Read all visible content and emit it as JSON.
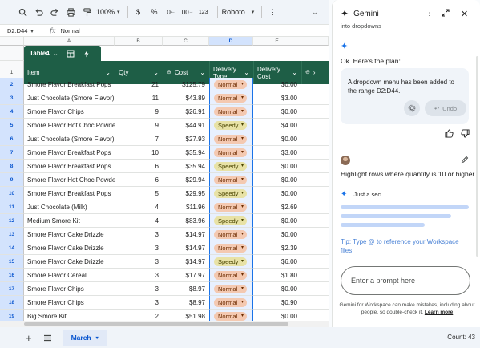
{
  "toolbar": {
    "zoom": "100%",
    "currency": "$",
    "percent": "%",
    "dec_decrease": ".0",
    "dec_increase": ".00",
    "format_123": "123",
    "font": "Roboto"
  },
  "formula_bar": {
    "range": "D2:D44",
    "fx": "fx",
    "value": "Normal"
  },
  "columns": [
    "A",
    "B",
    "C",
    "D",
    "E"
  ],
  "table": {
    "name": "Table4",
    "headers": [
      "Item",
      "Qty",
      "Cost",
      "Delivery Type",
      "Delivery Cost"
    ],
    "header_lines": {
      "delivery_type": [
        "Delivery",
        "Type"
      ],
      "delivery_cost": [
        "Delivery",
        "Cost"
      ]
    },
    "rows": [
      {
        "n": "2",
        "item": "Smore Flavor Breakfast Pops",
        "qty": "21",
        "cost": "$125.79",
        "type": "Normal",
        "dcost": "$0.00"
      },
      {
        "n": "3",
        "item": "Just Chocolate (Smore Flavor)",
        "qty": "11",
        "cost": "$43.89",
        "type": "Normal",
        "dcost": "$3.00"
      },
      {
        "n": "4",
        "item": "Smore Flavor Chips",
        "qty": "9",
        "cost": "$26.91",
        "type": "Normal",
        "dcost": "$0.00"
      },
      {
        "n": "5",
        "item": "Smore Flavor Hot Choc Powder",
        "qty": "9",
        "cost": "$44.91",
        "type": "Speedy",
        "dcost": "$4.00"
      },
      {
        "n": "6",
        "item": "Just Chocolate (Smore Flavor)",
        "qty": "7",
        "cost": "$27.93",
        "type": "Normal",
        "dcost": "$0.00"
      },
      {
        "n": "7",
        "item": "Smore Flavor Breakfast Pops",
        "qty": "10",
        "cost": "$35.94",
        "type": "Normal",
        "dcost": "$3.00"
      },
      {
        "n": "8",
        "item": "Smore Flavor Breakfast Pops",
        "qty": "6",
        "cost": "$35.94",
        "type": "Speedy",
        "dcost": "$0.00"
      },
      {
        "n": "9",
        "item": "Smore Flavor Hot Choc Powder",
        "qty": "6",
        "cost": "$29.94",
        "type": "Normal",
        "dcost": "$0.00"
      },
      {
        "n": "10",
        "item": "Smore Flavor Breakfast Pops",
        "qty": "5",
        "cost": "$29.95",
        "type": "Speedy",
        "dcost": "$0.00"
      },
      {
        "n": "11",
        "item": "Just Chocolate (Milk)",
        "qty": "4",
        "cost": "$11.96",
        "type": "Normal",
        "dcost": "$2.69"
      },
      {
        "n": "12",
        "item": "Medium Smore Kit",
        "qty": "4",
        "cost": "$83.96",
        "type": "Speedy",
        "dcost": "$0.00"
      },
      {
        "n": "13",
        "item": "Smore Flavor Cake Drizzle",
        "qty": "3",
        "cost": "$14.97",
        "type": "Normal",
        "dcost": "$0.00"
      },
      {
        "n": "14",
        "item": "Smore Flavor Cake Drizzle",
        "qty": "3",
        "cost": "$14.97",
        "type": "Normal",
        "dcost": "$2.39"
      },
      {
        "n": "15",
        "item": "Smore Flavor Cake Drizzle",
        "qty": "3",
        "cost": "$14.97",
        "type": "Speedy",
        "dcost": "$6.00"
      },
      {
        "n": "16",
        "item": "Smore Flavor Cereal",
        "qty": "3",
        "cost": "$17.97",
        "type": "Normal",
        "dcost": "$1.80"
      },
      {
        "n": "17",
        "item": "Smore Flavor Chips",
        "qty": "3",
        "cost": "$8.97",
        "type": "Normal",
        "dcost": "$0.00"
      },
      {
        "n": "18",
        "item": "Smore Flavor Chips",
        "qty": "3",
        "cost": "$8.97",
        "type": "Normal",
        "dcost": "$0.90"
      },
      {
        "n": "19",
        "item": "Big Smore Kit",
        "qty": "2",
        "cost": "$51.98",
        "type": "Normal",
        "dcost": "$0.00"
      }
    ]
  },
  "sheet_tab": "March",
  "count_label": "Count: 43",
  "gemini": {
    "title": "Gemini",
    "cut_text": "into dropdowns",
    "plan_intro": "Ok. Here's the plan:",
    "card_msg": "A dropdown menu has been added to the range D2:D44.",
    "undo_label": "Undo",
    "user_prompt": "Highlight rows where quantity is 10 or higher",
    "thinking": "Just a sec...",
    "tip": "Tip: Type @ to reference your Workspace files",
    "input_placeholder": "Enter a prompt here",
    "disclaimer": "Gemini for Workspace can make mistakes, including about people, so double-check it.",
    "learn_more": "Learn more"
  },
  "colors": {
    "table_header": "#1e5e46",
    "chip_normal": "#f4c9b1",
    "chip_speedy": "#e8e2a6",
    "selection": "#1a73e8"
  }
}
